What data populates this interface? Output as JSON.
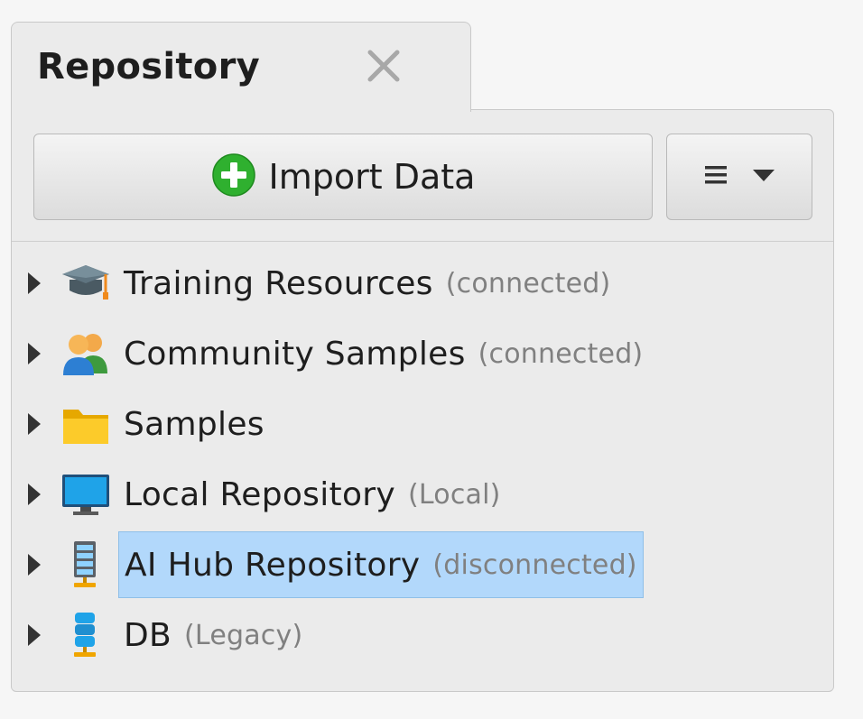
{
  "tab": {
    "title": "Repository",
    "close_icon": "close-icon"
  },
  "toolbar": {
    "import_label": "Import Data",
    "import_icon": "plus-circle-icon",
    "menu_icon": "hamburger-menu-icon",
    "menu_arrow_icon": "chevron-down-icon"
  },
  "tree": {
    "items": [
      {
        "name": "Training Resources",
        "status": "(connected)",
        "icon": "graduation-cap-icon",
        "selected": false
      },
      {
        "name": "Community Samples",
        "status": "(connected)",
        "icon": "users-icon",
        "selected": false
      },
      {
        "name": "Samples",
        "status": "",
        "icon": "folder-icon",
        "selected": false
      },
      {
        "name": "Local Repository",
        "status": "(Local)",
        "icon": "monitor-icon",
        "selected": false
      },
      {
        "name": "AI Hub Repository",
        "status": "(disconnected)",
        "icon": "server-icon",
        "selected": true
      },
      {
        "name": "DB",
        "status": "(Legacy)",
        "icon": "database-icon",
        "selected": false
      }
    ]
  },
  "colors": {
    "selection": "#b2d8fb",
    "accent_green": "#2fb02f",
    "status_gray": "#808080"
  }
}
